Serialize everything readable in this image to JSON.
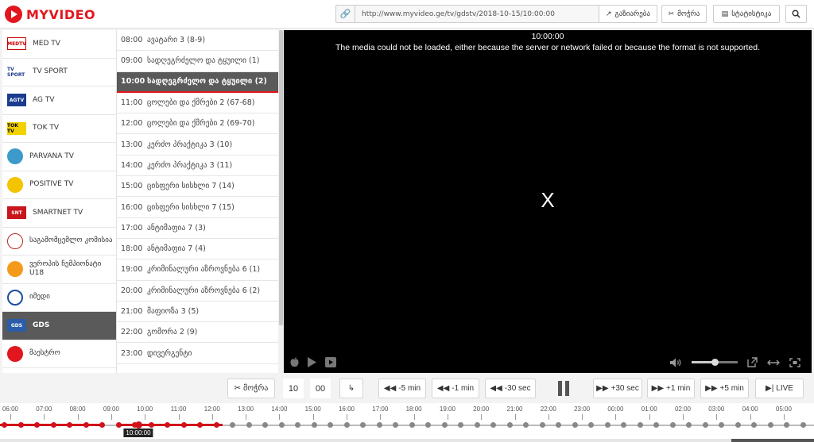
{
  "header": {
    "logo_text": "MYVIDEO",
    "url": "http://www.myvideo.ge/tv/gdstv/2018-10-15/10:00:00",
    "share_label": "გაზიარება",
    "cut_label": "მოჭრა",
    "stats_label": "სტატისტიკა"
  },
  "channels": [
    {
      "name": "MED TV",
      "logo": "MEDTV"
    },
    {
      "name": "TV SPORT",
      "logo": "TV SPORT"
    },
    {
      "name": "AG TV",
      "logo": "AGTV"
    },
    {
      "name": "TOK TV",
      "logo": "TOK TV"
    },
    {
      "name": "PARVANA TV",
      "logo": ""
    },
    {
      "name": "POSITIVE TV",
      "logo": ""
    },
    {
      "name": "SMARTNET TV",
      "logo": "SNT"
    },
    {
      "name": "საგამომცემლო კომისია",
      "logo": ""
    },
    {
      "name": "ვეროპის ჩემპიონატი U18",
      "logo": ""
    },
    {
      "name": "იმედი",
      "logo": ""
    },
    {
      "name": "GDS",
      "logo": "GDS",
      "active": true
    },
    {
      "name": "მაესტრო",
      "logo": ""
    }
  ],
  "schedule": [
    {
      "time": "08:00",
      "title": "ავატარი 3 (8-9)"
    },
    {
      "time": "09:00",
      "title": "სადღეგრძელო და ტყუილი (1)"
    },
    {
      "time": "10:00",
      "title": "სადღეგრძელო და ტყუილი (2)",
      "active": true
    },
    {
      "time": "11:00",
      "title": "ცოლები და ქმრები 2 (67-68)"
    },
    {
      "time": "12:00",
      "title": "ცოლები და ქმრები 2 (69-70)"
    },
    {
      "time": "13:00",
      "title": "კერძო პრაქტიკა 3 (10)"
    },
    {
      "time": "14:00",
      "title": "კერძო პრაქტიკა 3 (11)"
    },
    {
      "time": "15:00",
      "title": "ცისფერი სისხლი 7 (14)"
    },
    {
      "time": "16:00",
      "title": "ცისფერი სისხლი 7 (15)"
    },
    {
      "time": "17:00",
      "title": "ანტიმაფია 7 (3)"
    },
    {
      "time": "18:00",
      "title": "ანტიმაფია 7 (4)"
    },
    {
      "time": "19:00",
      "title": "კრიმინალური აზროვნება 6 (1)"
    },
    {
      "time": "20:00",
      "title": "კრიმინალური აზროვნება 6 (2)"
    },
    {
      "time": "21:00",
      "title": "მაფიოზა 3 (5)"
    },
    {
      "time": "22:00",
      "title": "გომორა 2 (9)"
    },
    {
      "time": "23:00",
      "title": "დივერგენტი"
    },
    {
      "time": "",
      "title": ""
    }
  ],
  "video": {
    "time": "10:00:00",
    "error": "The media could not be loaded, either because the server or network failed or because the format is not supported.",
    "close": "X",
    "volume_level": 0.5
  },
  "controls": {
    "cut_label": "მოჭრა",
    "hour": "10",
    "minute": "00",
    "back5": "-5 min",
    "back1": "-1 min",
    "back30s": "-30 sec",
    "fwd30s": "+30 sec",
    "fwd1": "+1 min",
    "fwd5": "+5 min",
    "live": "LIVE"
  },
  "timeline": {
    "labels": [
      "06:00",
      "07:00",
      "08:00",
      "09:00",
      "10:00",
      "11:00",
      "12:00",
      "13:00",
      "14:00",
      "15:00",
      "16:00",
      "17:00",
      "18:00",
      "19:00",
      "20:00",
      "21:00",
      "22:00",
      "23:00",
      "00:00",
      "01:00",
      "02:00",
      "03:00",
      "04:00",
      "05:00"
    ],
    "current": "10:00:00"
  }
}
